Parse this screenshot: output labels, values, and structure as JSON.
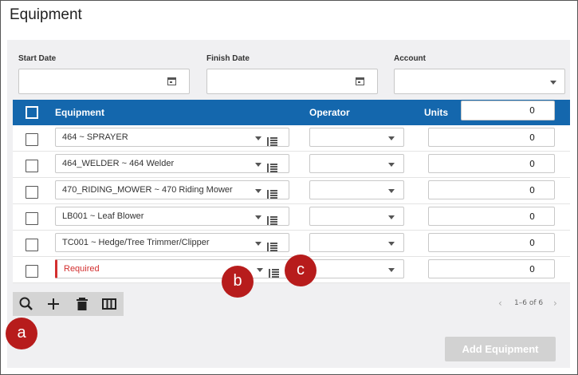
{
  "page": {
    "title": "Equipment"
  },
  "filters": {
    "start_date": {
      "label": "Start Date",
      "value": ""
    },
    "finish_date": {
      "label": "Finish Date",
      "value": ""
    },
    "account": {
      "label": "Account",
      "value": ""
    }
  },
  "table": {
    "columns": {
      "equipment": "Equipment",
      "operator": "Operator",
      "units": "Units"
    },
    "header_units_value": "0",
    "rows": [
      {
        "equipment": "464 ~ SPRAYER",
        "operator": "",
        "units": "0"
      },
      {
        "equipment": "464_WELDER ~ 464 Welder",
        "operator": "",
        "units": "0"
      },
      {
        "equipment": "470_RIDING_MOWER ~ 470 Riding Mower",
        "operator": "",
        "units": "0"
      },
      {
        "equipment": "LB001 ~ Leaf Blower",
        "operator": "",
        "units": "0"
      },
      {
        "equipment": "TC001 ~ Hedge/Tree Trimmer/Clipper",
        "operator": "",
        "units": "0"
      },
      {
        "equipment": "Required",
        "operator": "",
        "units": "0",
        "required": true
      }
    ]
  },
  "pagination": {
    "text": "1–6 of 6"
  },
  "actions": {
    "add_equipment": "Add Equipment"
  },
  "callouts": {
    "a": "a",
    "b": "b",
    "c": "c"
  },
  "colors": {
    "header": "#1467ad",
    "required": "#d32f2f",
    "callout": "#b71c1c"
  },
  "icons": [
    "search-icon",
    "plus-icon",
    "trash-icon",
    "columns-icon",
    "calendar-icon",
    "chevron-down-icon",
    "hierarchy-list-icon",
    "chevron-left-icon",
    "chevron-right-icon"
  ]
}
